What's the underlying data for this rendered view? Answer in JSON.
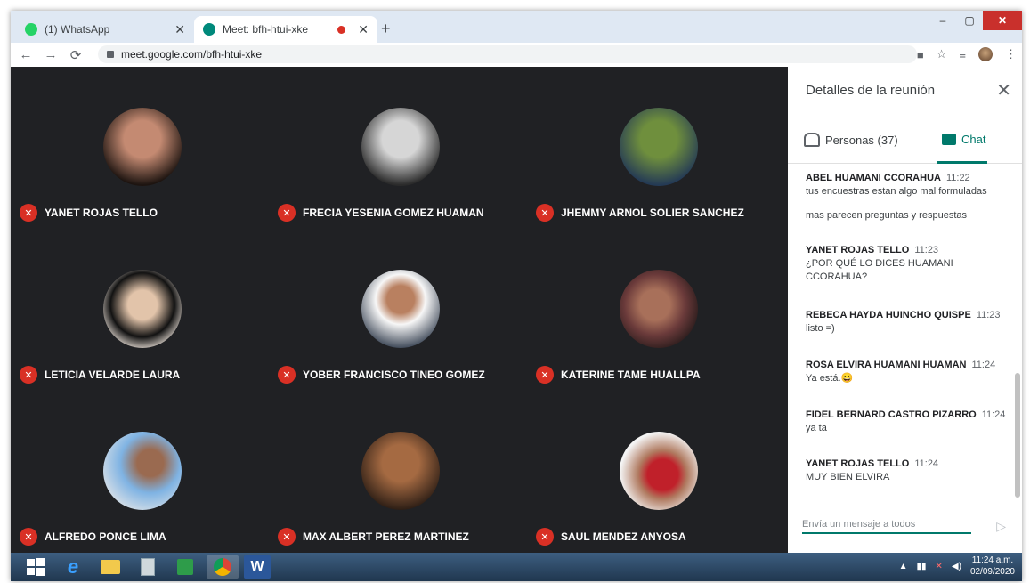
{
  "browser": {
    "tabs": [
      {
        "title": "(1) WhatsApp",
        "favicon_color": "#25d366"
      },
      {
        "title": "Meet: bfh-htui-xke",
        "favicon_color": "#00897b"
      }
    ],
    "new_tab_label": "+",
    "url": "meet.google.com/bfh-htui-xke",
    "win_min": "–",
    "win_max": "▢",
    "win_close": "✕"
  },
  "participants": [
    {
      "name": "YANET ROJAS TELLO",
      "avatar_colors": [
        "#c48a72",
        "#1d1410"
      ]
    },
    {
      "name": "FRECIA YESENIA GOMEZ HUAMAN",
      "avatar_colors": [
        "#d6d6d6",
        "#2b2b2b"
      ]
    },
    {
      "name": "JHEMMY ARNOL SOLIER SANCHEZ",
      "avatar_colors": [
        "#6f8f3d",
        "#243a55"
      ]
    },
    {
      "name": "LETICIA VELARDE LAURA",
      "avatar_colors": [
        "#f0e6dd",
        "#121212"
      ]
    },
    {
      "name": "YOBER FRANCISCO TINEO GOMEZ",
      "avatar_colors": [
        "#f7f7f7",
        "#1f2b3d"
      ]
    },
    {
      "name": "KATERINE TAME HUALLPA",
      "avatar_colors": [
        "#6a3a3a",
        "#221818"
      ]
    },
    {
      "name": "ALFREDO PONCE LIMA",
      "avatar_colors": [
        "#7fb3e3",
        "#e8e8e8"
      ]
    },
    {
      "name": "MAX ALBERT PEREZ MARTINEZ",
      "avatar_colors": [
        "#a56a42",
        "#2a1c14"
      ]
    },
    {
      "name": "SAUL MENDEZ ANYOSA",
      "avatar_colors": [
        "#f4f4f4",
        "#c0202a"
      ]
    }
  ],
  "panel": {
    "title": "Detalles de la reunión",
    "close_label": "✕",
    "people_tab": "Personas (37)",
    "chat_tab": "Chat",
    "messages": [
      {
        "author": "ABEL HUAMANI CCORAHUA",
        "time": "11:22",
        "text": "tus encuestras estan algo mal formuladas"
      },
      {
        "author": "",
        "time": "",
        "text": "mas parecen preguntas y respuestas"
      },
      {
        "author": "YANET ROJAS TELLO",
        "time": "11:23",
        "text": "¿POR QUÉ LO DICES HUAMANI CCORAHUA?"
      },
      {
        "author": "REBECA HAYDA HUINCHO QUISPE",
        "time": "11:23",
        "text": "listo =)"
      },
      {
        "author": "ROSA ELVIRA HUAMANI HUAMAN",
        "time": "11:24",
        "text": "Ya está.😀"
      },
      {
        "author": "FIDEL BERNARD CASTRO PIZARRO",
        "time": "11:24",
        "text": "ya ta"
      },
      {
        "author": "YANET ROJAS TELLO",
        "time": "11:24",
        "text": "MUY BIEN ELVIRA"
      }
    ],
    "composer_placeholder": "Envía un mensaje a todos",
    "send_label": "▷"
  },
  "taskbar": {
    "time": "11:24 a.m.",
    "date": "02/09/2020",
    "word_label": "W",
    "ie_label": "e"
  },
  "colors": {
    "accent": "#00796b",
    "mic_off": "#d93025",
    "grid_bg": "#202124"
  }
}
